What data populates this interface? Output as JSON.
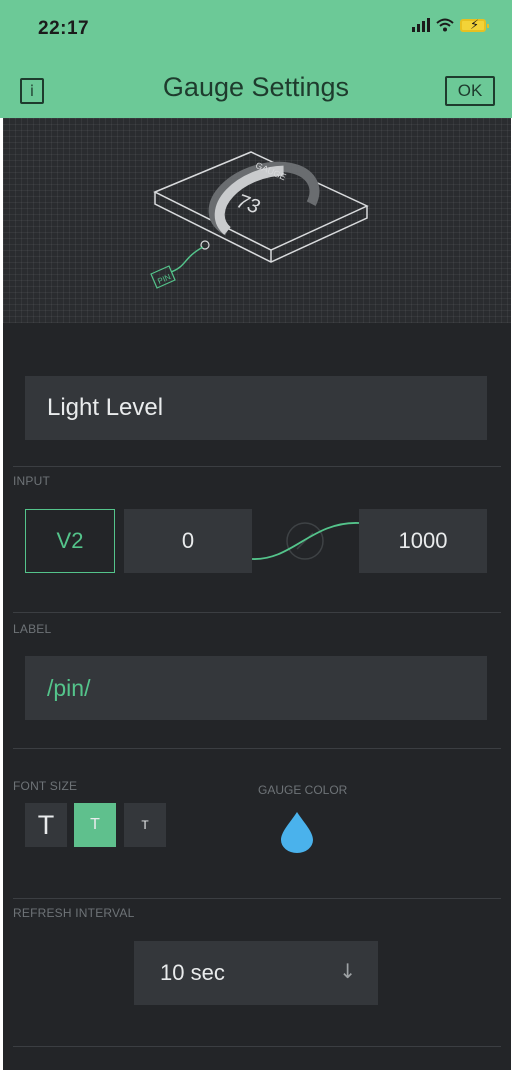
{
  "status_bar": {
    "time": "22:17"
  },
  "nav": {
    "info_label": "i",
    "title": "Gauge Settings",
    "ok_label": "OK"
  },
  "illustration": {
    "gauge_tag": "GAUGE",
    "gauge_value": "73",
    "pin_tag": "PIN"
  },
  "widget_name": "Light Level",
  "input": {
    "section_label": "INPUT",
    "pin": "V2",
    "min": "0",
    "max": "1000"
  },
  "label": {
    "section_label": "LABEL",
    "value": "/pin/"
  },
  "font_size": {
    "section_label": "FONT SIZE",
    "options": [
      "T",
      "T",
      "T"
    ],
    "selected_index": 1
  },
  "gauge_color": {
    "section_label": "GAUGE COLOR",
    "color": "#4ab2ec",
    "icon": "droplet-icon"
  },
  "refresh_interval": {
    "section_label": "REFRESH INTERVAL",
    "value": "10 sec",
    "icon": "arrow-down-icon"
  },
  "colors": {
    "header": "#6cc997",
    "accent": "#54c48b",
    "background": "#232528",
    "field": "#34373b"
  }
}
